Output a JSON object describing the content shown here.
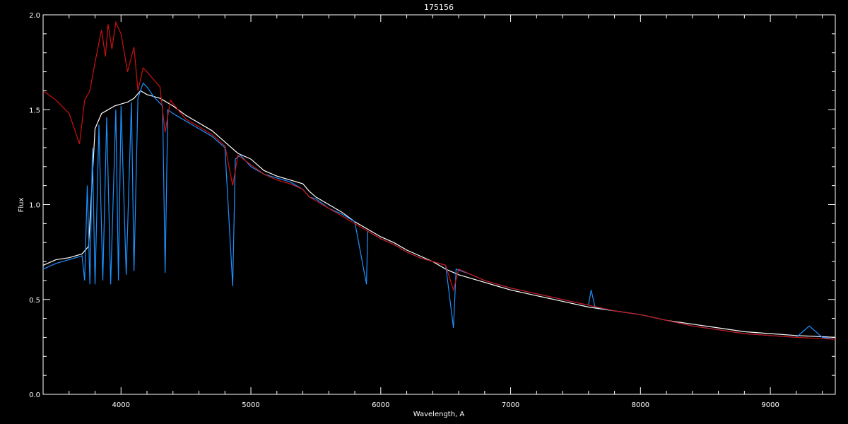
{
  "chart_data": {
    "type": "line",
    "title": "175156",
    "xlabel": "Wavelength, A",
    "ylabel": "Flux",
    "xlim": [
      3400,
      9500
    ],
    "ylim": [
      0.0,
      2.0
    ],
    "x_ticks": [
      4000,
      5000,
      6000,
      7000,
      8000,
      9000
    ],
    "y_ticks": [
      0.0,
      0.5,
      1.0,
      1.5,
      2.0
    ],
    "x_tick_labels": [
      "4000",
      "5000",
      "6000",
      "7000",
      "8000",
      "9000"
    ],
    "y_tick_labels": [
      "0.0",
      "0.5",
      "1.0",
      "1.5",
      "2.0"
    ],
    "grid": false,
    "background": "#000000",
    "series": [
      {
        "color": "#ffffff",
        "points": [
          [
            3400,
            0.68
          ],
          [
            3500,
            0.71
          ],
          [
            3600,
            0.72
          ],
          [
            3700,
            0.74
          ],
          [
            3750,
            0.78
          ],
          [
            3800,
            1.4
          ],
          [
            3850,
            1.48
          ],
          [
            3900,
            1.5
          ],
          [
            3950,
            1.52
          ],
          [
            4000,
            1.53
          ],
          [
            4050,
            1.54
          ],
          [
            4100,
            1.56
          ],
          [
            4150,
            1.6
          ],
          [
            4200,
            1.58
          ],
          [
            4300,
            1.56
          ],
          [
            4400,
            1.52
          ],
          [
            4500,
            1.47
          ],
          [
            4600,
            1.43
          ],
          [
            4700,
            1.39
          ],
          [
            4800,
            1.33
          ],
          [
            4900,
            1.27
          ],
          [
            5000,
            1.24
          ],
          [
            5100,
            1.18
          ],
          [
            5200,
            1.15
          ],
          [
            5300,
            1.13
          ],
          [
            5400,
            1.11
          ],
          [
            5450,
            1.07
          ],
          [
            5500,
            1.04
          ],
          [
            5600,
            1.0
          ],
          [
            5700,
            0.96
          ],
          [
            5800,
            0.91
          ],
          [
            5900,
            0.87
          ],
          [
            6000,
            0.83
          ],
          [
            6100,
            0.8
          ],
          [
            6200,
            0.76
          ],
          [
            6300,
            0.73
          ],
          [
            6400,
            0.7
          ],
          [
            6500,
            0.66
          ],
          [
            6600,
            0.63
          ],
          [
            6700,
            0.61
          ],
          [
            6800,
            0.59
          ],
          [
            6900,
            0.57
          ],
          [
            7000,
            0.55
          ],
          [
            7200,
            0.52
          ],
          [
            7400,
            0.49
          ],
          [
            7600,
            0.46
          ],
          [
            7800,
            0.44
          ],
          [
            8000,
            0.42
          ],
          [
            8200,
            0.39
          ],
          [
            8400,
            0.37
          ],
          [
            8600,
            0.35
          ],
          [
            8800,
            0.33
          ],
          [
            9000,
            0.32
          ],
          [
            9200,
            0.31
          ],
          [
            9500,
            0.3
          ]
        ]
      },
      {
        "color": "#1e90ff",
        "points": [
          [
            3400,
            0.66
          ],
          [
            3500,
            0.69
          ],
          [
            3600,
            0.71
          ],
          [
            3700,
            0.73
          ],
          [
            3720,
            0.6
          ],
          [
            3740,
            1.1
          ],
          [
            3760,
            0.58
          ],
          [
            3780,
            1.3
          ],
          [
            3800,
            0.58
          ],
          [
            3830,
            1.42
          ],
          [
            3860,
            0.6
          ],
          [
            3890,
            1.46
          ],
          [
            3920,
            0.58
          ],
          [
            3960,
            1.5
          ],
          [
            3980,
            0.6
          ],
          [
            4000,
            1.52
          ],
          [
            4040,
            0.63
          ],
          [
            4080,
            1.54
          ],
          [
            4100,
            0.65
          ],
          [
            4130,
            1.56
          ],
          [
            4170,
            1.64
          ],
          [
            4200,
            1.62
          ],
          [
            4250,
            1.57
          ],
          [
            4320,
            1.52
          ],
          [
            4340,
            0.64
          ],
          [
            4360,
            1.5
          ],
          [
            4400,
            1.48
          ],
          [
            4500,
            1.44
          ],
          [
            4600,
            1.4
          ],
          [
            4700,
            1.36
          ],
          [
            4800,
            1.3
          ],
          [
            4860,
            0.57
          ],
          [
            4880,
            1.24
          ],
          [
            4920,
            1.26
          ],
          [
            5000,
            1.2
          ],
          [
            5100,
            1.16
          ],
          [
            5200,
            1.14
          ],
          [
            5300,
            1.12
          ],
          [
            5400,
            1.08
          ],
          [
            5450,
            1.04
          ],
          [
            5500,
            1.03
          ],
          [
            5600,
            0.98
          ],
          [
            5700,
            0.95
          ],
          [
            5800,
            0.91
          ],
          [
            5890,
            0.58
          ],
          [
            5900,
            0.86
          ],
          [
            6000,
            0.82
          ],
          [
            6100,
            0.79
          ],
          [
            6200,
            0.75
          ],
          [
            6300,
            0.72
          ],
          [
            6400,
            0.7
          ],
          [
            6500,
            0.68
          ],
          [
            6560,
            0.35
          ],
          [
            6580,
            0.66
          ],
          [
            6700,
            0.63
          ],
          [
            6800,
            0.6
          ],
          [
            6900,
            0.58
          ],
          [
            7000,
            0.56
          ],
          [
            7200,
            0.53
          ],
          [
            7400,
            0.5
          ],
          [
            7600,
            0.47
          ],
          [
            7620,
            0.55
          ],
          [
            7650,
            0.46
          ],
          [
            7800,
            0.44
          ],
          [
            8000,
            0.42
          ],
          [
            8200,
            0.39
          ],
          [
            8400,
            0.36
          ],
          [
            8600,
            0.34
          ],
          [
            8800,
            0.32
          ],
          [
            9000,
            0.31
          ],
          [
            9200,
            0.3
          ],
          [
            9300,
            0.36
          ],
          [
            9400,
            0.3
          ],
          [
            9500,
            0.29
          ]
        ]
      },
      {
        "color": "#cc1111",
        "points": [
          [
            3400,
            1.6
          ],
          [
            3500,
            1.55
          ],
          [
            3600,
            1.48
          ],
          [
            3680,
            1.32
          ],
          [
            3720,
            1.55
          ],
          [
            3760,
            1.6
          ],
          [
            3800,
            1.75
          ],
          [
            3850,
            1.92
          ],
          [
            3880,
            1.78
          ],
          [
            3900,
            1.95
          ],
          [
            3930,
            1.82
          ],
          [
            3960,
            1.96
          ],
          [
            4000,
            1.9
          ],
          [
            4050,
            1.7
          ],
          [
            4100,
            1.83
          ],
          [
            4130,
            1.6
          ],
          [
            4170,
            1.72
          ],
          [
            4200,
            1.7
          ],
          [
            4300,
            1.62
          ],
          [
            4340,
            1.38
          ],
          [
            4380,
            1.55
          ],
          [
            4450,
            1.49
          ],
          [
            4500,
            1.45
          ],
          [
            4600,
            1.41
          ],
          [
            4700,
            1.37
          ],
          [
            4800,
            1.31
          ],
          [
            4860,
            1.1
          ],
          [
            4900,
            1.26
          ],
          [
            5000,
            1.21
          ],
          [
            5100,
            1.16
          ],
          [
            5200,
            1.13
          ],
          [
            5300,
            1.11
          ],
          [
            5400,
            1.08
          ],
          [
            5450,
            1.04
          ],
          [
            5500,
            1.02
          ],
          [
            5600,
            0.98
          ],
          [
            5700,
            0.94
          ],
          [
            5800,
            0.9
          ],
          [
            5900,
            0.86
          ],
          [
            6000,
            0.82
          ],
          [
            6100,
            0.79
          ],
          [
            6200,
            0.75
          ],
          [
            6300,
            0.72
          ],
          [
            6400,
            0.7
          ],
          [
            6500,
            0.68
          ],
          [
            6560,
            0.55
          ],
          [
            6600,
            0.66
          ],
          [
            6700,
            0.63
          ],
          [
            6800,
            0.6
          ],
          [
            6900,
            0.58
          ],
          [
            7000,
            0.56
          ],
          [
            7200,
            0.53
          ],
          [
            7400,
            0.5
          ],
          [
            7600,
            0.47
          ],
          [
            7800,
            0.44
          ],
          [
            8000,
            0.42
          ],
          [
            8200,
            0.39
          ],
          [
            8400,
            0.36
          ],
          [
            8600,
            0.34
          ],
          [
            8800,
            0.32
          ],
          [
            9000,
            0.31
          ],
          [
            9200,
            0.3
          ],
          [
            9500,
            0.29
          ]
        ]
      }
    ]
  }
}
